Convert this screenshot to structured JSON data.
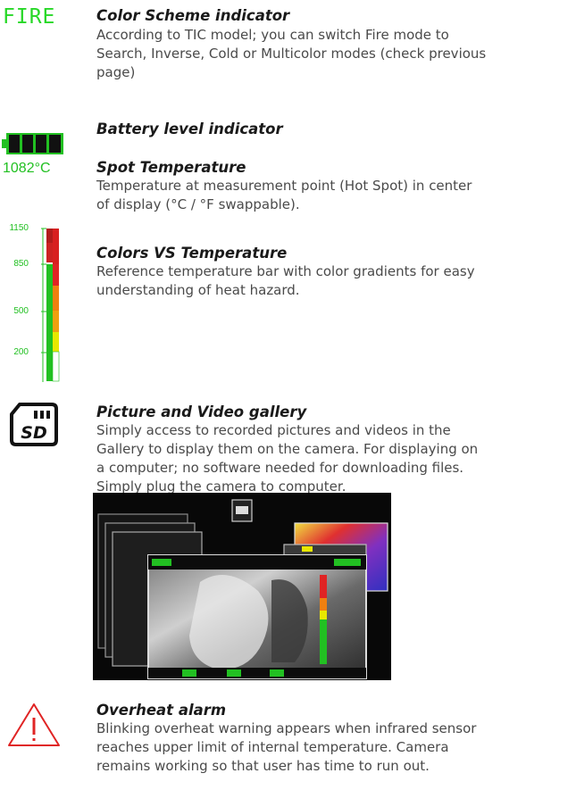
{
  "icons": {
    "color_scheme_label": "FIRE",
    "spot_temperature_value": "1082°C",
    "battery_icon": "battery-full-icon",
    "sd_icon": "sd-card-icon",
    "sd_label": "SD",
    "warning_icon": "warning-triangle-icon"
  },
  "colors": {
    "green": "#22c022",
    "red": "#e02424",
    "orange": "#f08010",
    "yellow": "#e8e800"
  },
  "temperature_bar": {
    "ticks": [
      "1150",
      "850",
      "500",
      "200"
    ]
  },
  "sections": [
    {
      "title": "Color Scheme indicator",
      "lines": [
        "According to TIC model; you can switch Fire mode to",
        "Search, Inverse, Cold or Multicolor modes (check previous",
        "page)"
      ]
    },
    {
      "title": "Battery level indicator",
      "lines": []
    },
    {
      "title": "Spot Temperature",
      "lines": [
        "Temperature at measurement point (Hot Spot) in center",
        "of display (°C / °F swappable)."
      ]
    },
    {
      "title": "Colors VS Temperature",
      "lines": [
        "Reference temperature bar with color gradients for easy",
        "understanding of heat hazard."
      ]
    },
    {
      "title": "Picture and Video gallery",
      "lines": [
        "Simply access to recorded pictures and videos in the",
        "Gallery to display them on the camera. For displaying on",
        "a computer; no software needed for downloading files.",
        "Simply plug the camera to computer."
      ]
    },
    {
      "title": "Overheat alarm",
      "lines": [
        "Blinking overheat warning appears when infrared sensor",
        "reaches upper limit of internal temperature. Camera",
        "remains working so that user has time to run out."
      ]
    }
  ]
}
